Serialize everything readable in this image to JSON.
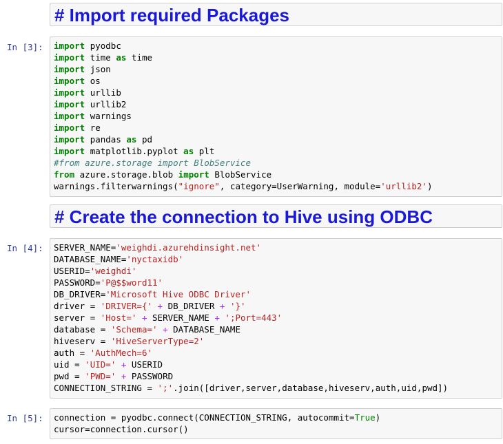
{
  "headings": {
    "import": "# Import required Packages",
    "connection": "# Create the connection to Hive using ODBC"
  },
  "prompts": {
    "cell3": "In [3]:",
    "cell4": "In [4]:",
    "cell5": "In [5]:"
  },
  "cell3_lines": [
    "import pyodbc",
    "import time as time",
    "import json",
    "import os",
    "import urllib",
    "import urllib2",
    "import warnings",
    "import re",
    "import pandas as pd",
    "import matplotlib.pyplot as plt",
    "#from azure.storage import BlobService",
    "from azure.storage.blob import BlobService",
    "warnings.filterwarnings(\"ignore\", category=UserWarning, module='urllib2')"
  ],
  "cell4_lines": [
    "SERVER_NAME='weighdi.azurehdinsight.net'",
    "DATABASE_NAME='nyctaxidb'",
    "USERID='weighdi'",
    "PASSWORD='P@$$word11'",
    "DB_DRIVER='Microsoft Hive ODBC Driver'",
    "driver = 'DRIVER={' + DB_DRIVER + '}'",
    "server = 'Host=' + SERVER_NAME + ';Port=443'",
    "database = 'Schema=' + DATABASE_NAME",
    "hiveserv = 'HiveServerType=2'",
    "auth = 'AuthMech=6'",
    "uid = 'UID=' + USERID",
    "pwd = 'PWD=' + PASSWORD",
    "CONNECTION_STRING = ';'.join([driver,server,database,hiveserv,auth,uid,pwd])"
  ],
  "cell5_lines": [
    "connection = pyodbc.connect(CONNECTION_STRING, autocommit=True)",
    "cursor=connection.cursor()"
  ],
  "colors": {
    "heading": "#1a1ad6",
    "prompt": "#303f9f",
    "keyword": "#008000",
    "string": "#ba2121",
    "comment": "#408080",
    "operator": "#aa22ff",
    "cell_bg": "#f7f7f7",
    "cell_border": "#cfcfcf"
  }
}
